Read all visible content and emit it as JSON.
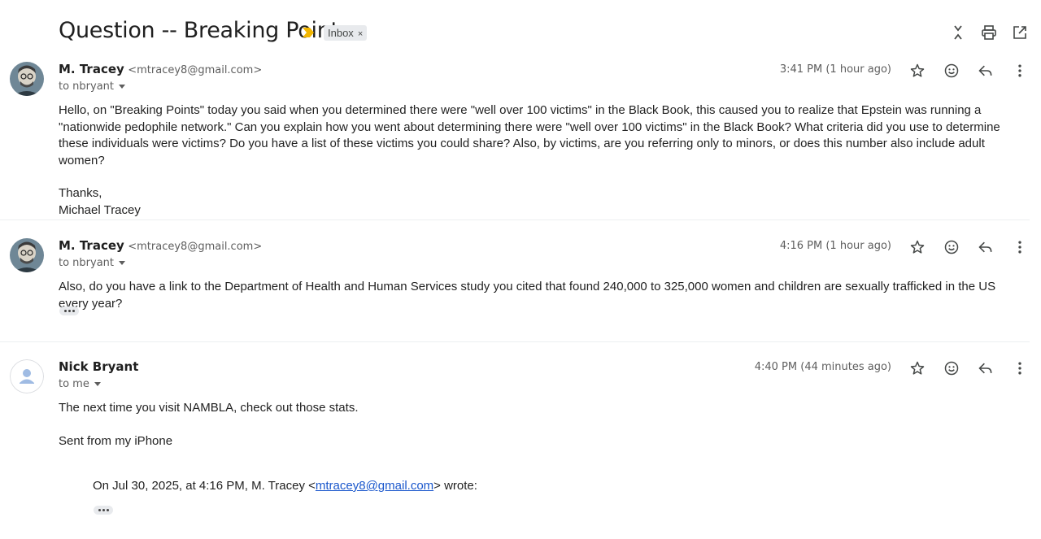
{
  "thread": {
    "subject": "Question -- Breaking Points",
    "label": "Inbox",
    "label_remove": "×",
    "icons": [
      "collapse-all-icon",
      "print-icon",
      "open-new-window-icon"
    ]
  },
  "messages": [
    {
      "sender_name": "M. Tracey",
      "sender_email": "<mtracey8@gmail.com>",
      "to": "to nbryant",
      "time": "3:41 PM (1 hour ago)",
      "body": [
        "Hello, on \"Breaking Points\" today you said when you determined there were \"well over 100 victims\" in the Black Book, this caused you to realize that Epstein was running a \"nationwide pedophile network.\" Can you explain how you went about determining there were \"well over 100 victims\" in the Black Book? What criteria did you use to determine these individuals were victims? Do you have a list of these victims you could share? Also, by victims, are you referring only to minors, or does this number also include adult women?"
      ],
      "closing": [
        "Thanks,",
        "Michael Tracey"
      ]
    },
    {
      "sender_name": "M. Tracey",
      "sender_email": "<mtracey8@gmail.com>",
      "to": "to nbryant",
      "time": "4:16 PM (1 hour ago)",
      "body": [
        "Also, do you have a link to the Department of Health and Human Services study you cited that found 240,000 to 325,000 women and children are sexually trafficked in the US every year?"
      ]
    },
    {
      "sender_name": "Nick Bryant",
      "to": "to me",
      "time": "4:40 PM (44 minutes ago)",
      "body": [
        "The next time you visit NAMBLA, check out those stats."
      ],
      "signature": "Sent from my iPhone",
      "quote": {
        "prefix": "On Jul 30, 2025, at 4:16 PM, M. Tracey <",
        "email": "mtracey8@gmail.com",
        "suffix": "> wrote:"
      }
    }
  ],
  "colors": {
    "link": "#1a57cc",
    "important_marker": "#f2b600",
    "label_chip_bg": "#e8eaed"
  }
}
